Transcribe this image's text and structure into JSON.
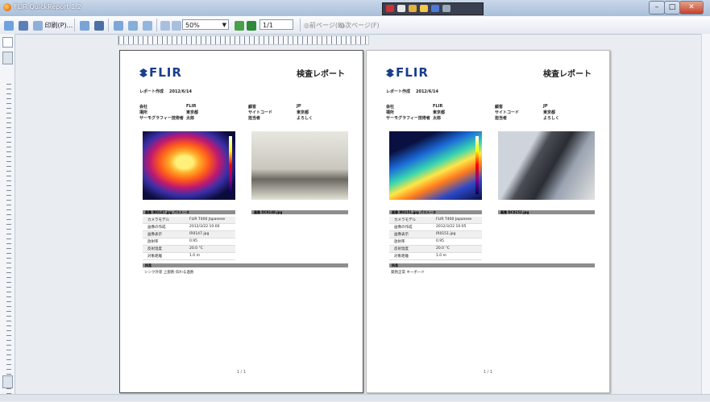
{
  "window": {
    "title": "FLIR QuickReport 1.2"
  },
  "toolbar": {
    "open_label": "印刷(P)...",
    "zoom_value": "50%",
    "page_value": "1/1",
    "btn_prev": "前ページ(B)",
    "btn_next": "次ページ(F)"
  },
  "pages": [
    {
      "title": "検査レポート",
      "date_label": "レポート作成",
      "date_value": "2012/6/14",
      "rows": [
        [
          "会社",
          "FLIR",
          "顧客",
          "JP"
        ],
        [
          "場所",
          "東京都",
          "サイトコード",
          "東京都"
        ],
        [
          "サーモグラフィー技術者",
          "太郎",
          "担当者",
          "よろしく"
        ]
      ],
      "sec_left": "画像 IR0147.jpg パラメータ",
      "sec_right": "画像 DC0148.jpg",
      "table": [
        [
          "カメラモデル",
          "FLIR T400 Japanese"
        ],
        [
          "画像の作成",
          "2012/3/22 10:00"
        ],
        [
          "画像表示",
          "IR0147.jpg"
        ],
        [
          "放射率",
          "0.95"
        ],
        [
          "反射温度",
          "20.0 °C"
        ],
        [
          "対象距離",
          "1.0 m"
        ]
      ],
      "sec_note": "所見",
      "note": "シンク外装 上部熱 伝わる過熱",
      "footer": "1 / 1"
    },
    {
      "title": "検査レポート",
      "date_label": "レポート作成",
      "date_value": "2012/6/14",
      "rows": [
        [
          "会社",
          "FLIR",
          "顧客",
          "JP"
        ],
        [
          "場所",
          "東京都",
          "サイトコード",
          "東京都"
        ],
        [
          "サーモグラフィー技術者",
          "太郎",
          "担当者",
          "よろしく"
        ]
      ],
      "sec_left": "画像 IR0151.jpg パラメータ",
      "sec_right": "画像 DC0152.jpg",
      "table": [
        [
          "カメラモデル",
          "FLIR T400 Japanese"
        ],
        [
          "画像の作成",
          "2012/3/22 10:05"
        ],
        [
          "画像表示",
          "IR0151.jpg"
        ],
        [
          "放射率",
          "0.95"
        ],
        [
          "反射温度",
          "20.0 °C"
        ],
        [
          "対象距離",
          "1.0 m"
        ]
      ],
      "sec_note": "所見",
      "note": "発熱正常 キーボード",
      "footer": "1 / 1"
    }
  ]
}
